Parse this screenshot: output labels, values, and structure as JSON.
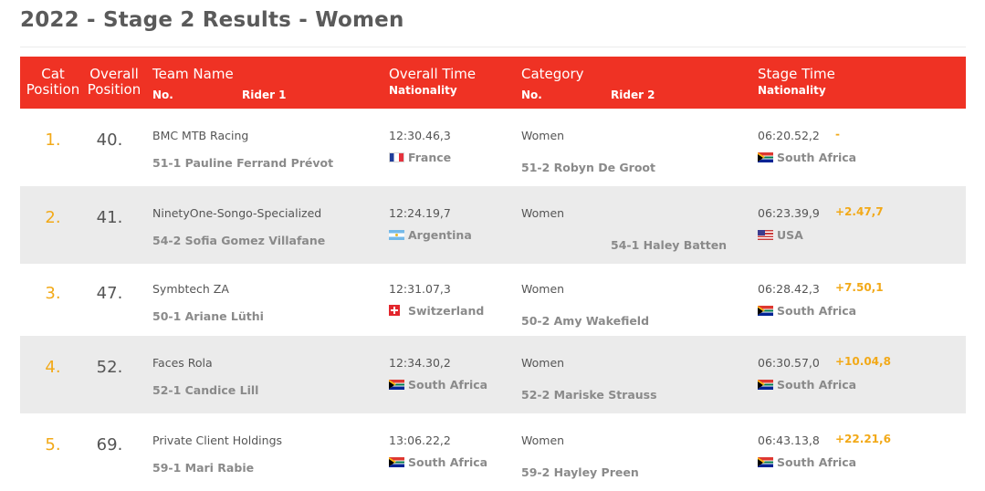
{
  "page": {
    "title": "2022 - Stage 2 Results - Women"
  },
  "table_header": {
    "cat_position_line1": "Cat",
    "cat_position_line2": "Position",
    "overall_position_line1": "Overall",
    "overall_position_line2": "Position",
    "team_name": "Team Name",
    "no_1": "No.",
    "rider_1": "Rider 1",
    "overall_time": "Overall Time",
    "nationality_1": "Nationality",
    "category": "Category",
    "no_2": "No.",
    "rider_2": "Rider 2",
    "stage_time": "Stage Time",
    "nationality_2": "Nationality"
  },
  "rows": [
    {
      "cat_position": "1.",
      "overall_position": "40.",
      "team": "BMC MTB Racing",
      "rider1": "51-1 Pauline Ferrand Prévot",
      "overall_time": "12:30.46,3",
      "rider1_flag": "flag-france",
      "rider1_nationality": "France",
      "category": "Women",
      "rider2": "51-2 Robyn De Groot",
      "stage_time": "06:20.52,2",
      "gap": "-",
      "rider2_flag": "flag-south-africa",
      "rider2_nationality": "South Africa"
    },
    {
      "cat_position": "2.",
      "overall_position": "41.",
      "team": "NinetyOne-Songo-Specialized",
      "rider1": "54-2 Sofia Gomez Villafane",
      "overall_time": "12:24.19,7",
      "rider1_flag": "flag-argentina",
      "rider1_nationality": "Argentina",
      "category": "Women",
      "rider2": "54-1 Haley Batten",
      "stage_time": "06:23.39,9",
      "gap": "+2.47,7",
      "rider2_flag": "flag-usa",
      "rider2_nationality": "USA"
    },
    {
      "cat_position": "3.",
      "overall_position": "47.",
      "team": "Symbtech ZA",
      "rider1": "50-1 Ariane Lüthi",
      "overall_time": "12:31.07,3",
      "rider1_flag": "flag-switzerland",
      "rider1_nationality": "Switzerland",
      "category": "Women",
      "rider2": "50-2 Amy Wakefield",
      "stage_time": "06:28.42,3",
      "gap": "+7.50,1",
      "rider2_flag": "flag-south-africa",
      "rider2_nationality": "South Africa"
    },
    {
      "cat_position": "4.",
      "overall_position": "52.",
      "team": "Faces Rola",
      "rider1": "52-1 Candice Lill",
      "overall_time": "12:34.30,2",
      "rider1_flag": "flag-south-africa",
      "rider1_nationality": "South Africa",
      "category": "Women",
      "rider2": "52-2 Mariske Strauss",
      "stage_time": "06:30.57,0",
      "gap": "+10.04,8",
      "rider2_flag": "flag-south-africa",
      "rider2_nationality": "South Africa"
    },
    {
      "cat_position": "5.",
      "overall_position": "69.",
      "team": "Private Client Holdings",
      "rider1": "59-1 Mari Rabie",
      "overall_time": "13:06.22,2",
      "rider1_flag": "flag-south-africa",
      "rider1_nationality": "South Africa",
      "category": "Women",
      "rider2": "59-2 Hayley Preen",
      "stage_time": "06:43.13,8",
      "gap": "+22.21,6",
      "rider2_flag": "flag-south-africa",
      "rider2_nationality": "South Africa"
    }
  ],
  "colors": {
    "header_bg": "#ef3224",
    "position_accent": "#f2a918",
    "row_alt_bg": "#ebebeb"
  }
}
